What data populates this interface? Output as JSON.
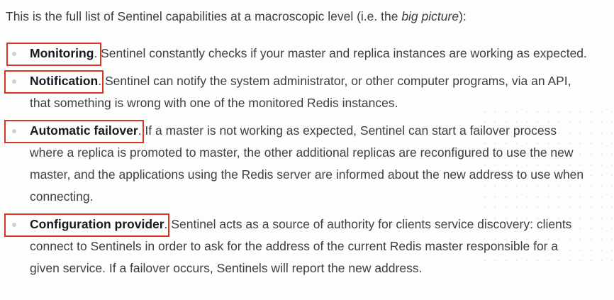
{
  "intro": {
    "prefix": "This is the full list of Sentinel capabilities at a macroscopic level (i.e. the ",
    "emphasis": "big picture",
    "suffix": "):"
  },
  "capabilities": [
    {
      "term": "Monitoring",
      "punct": ".",
      "text": " Sentinel constantly checks if your master and replica instances are working as expected."
    },
    {
      "term": "Notification",
      "punct": ".",
      "text": " Sentinel can notify the system administrator, or other computer programs, via an API, that something is wrong with one of the monitored Redis instances."
    },
    {
      "term": "Automatic failover",
      "punct": ".",
      "text": " If a master is not working as expected, Sentinel can start a failover process where a replica is promoted to master, the other additional replicas are reconfigured to use the new master, and the applications using the Redis server are informed about the new address to use when connecting."
    },
    {
      "term": "Configuration provider",
      "punct": ".",
      "text": " Sentinel acts as a source of authority for clients service discovery: clients connect to Sentinels in order to ask for the address of the current Redis master responsible for a given service. If a failover occurs, Sentinels will report the new address."
    }
  ],
  "colors": {
    "highlight_border": "#d93324",
    "bullet": "#c9d2e0",
    "text": "#3c4043",
    "term": "#161b22"
  }
}
